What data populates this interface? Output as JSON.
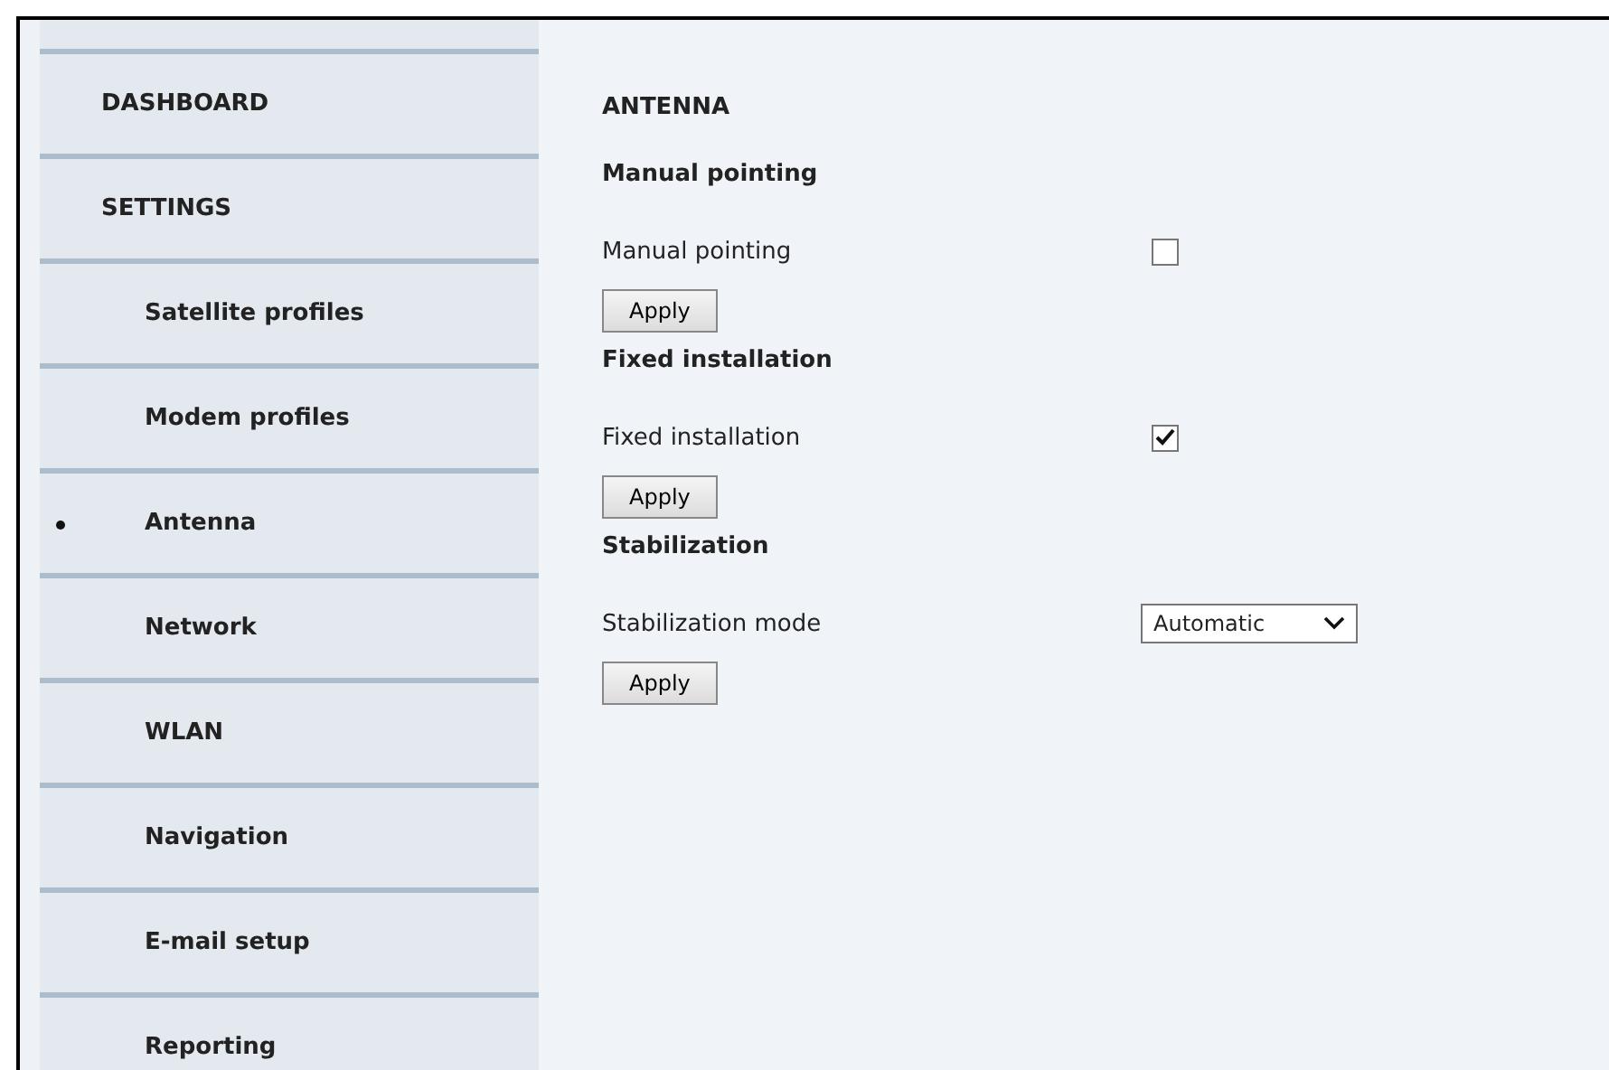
{
  "sidebar": {
    "items": [
      {
        "label": "DASHBOARD",
        "kind": "top",
        "selected": false
      },
      {
        "label": "SETTINGS",
        "kind": "top",
        "selected": false
      },
      {
        "label": "Satellite profiles",
        "kind": "sub",
        "selected": false
      },
      {
        "label": "Modem profiles",
        "kind": "sub",
        "selected": false
      },
      {
        "label": "Antenna",
        "kind": "sub",
        "selected": true
      },
      {
        "label": "Network",
        "kind": "sub",
        "selected": false
      },
      {
        "label": "WLAN",
        "kind": "sub",
        "selected": false
      },
      {
        "label": "Navigation",
        "kind": "sub",
        "selected": false
      },
      {
        "label": "E-mail setup",
        "kind": "sub",
        "selected": false
      },
      {
        "label": "Reporting",
        "kind": "sub",
        "selected": false
      }
    ]
  },
  "page": {
    "title": "ANTENNA",
    "sections": [
      {
        "heading": "Manual pointing",
        "field": {
          "kind": "checkbox",
          "label": "Manual pointing",
          "checked": false
        },
        "button": "Apply"
      },
      {
        "heading": "Fixed installation",
        "field": {
          "kind": "checkbox",
          "label": "Fixed installation",
          "checked": true
        },
        "button": "Apply"
      },
      {
        "heading": "Stabilization",
        "field": {
          "kind": "select",
          "label": "Stabilization mode",
          "value": "Automatic"
        },
        "button": "Apply"
      }
    ]
  }
}
